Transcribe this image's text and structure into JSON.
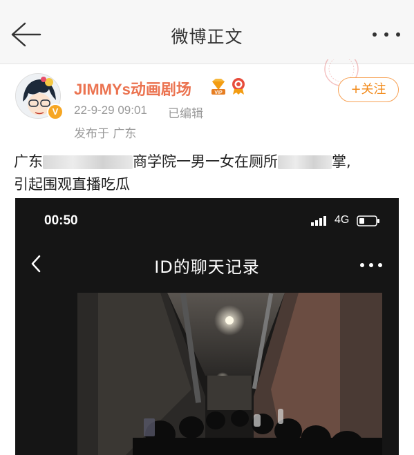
{
  "nav": {
    "title": "微博正文",
    "back_icon": "arrow-left-icon",
    "more_icon": "more-horizontal-icon"
  },
  "post": {
    "username": "JIMMYs动画剧场",
    "timestamp": "22-9-29 09:01",
    "edited": "已编辑",
    "location": "发布于 广东",
    "follow_label": "+关注",
    "text_part1": "广东",
    "text_part2": "商学院一男一女在厕所",
    "text_part3": "掌,",
    "text_line2": "引起围观直播吃瓜",
    "colors": {
      "username": "#eb7350",
      "follow": "#f28a1a",
      "meta": "#999999"
    }
  },
  "embed": {
    "status_time": "00:50",
    "network": "4G",
    "title": "ID的聊天记录"
  }
}
